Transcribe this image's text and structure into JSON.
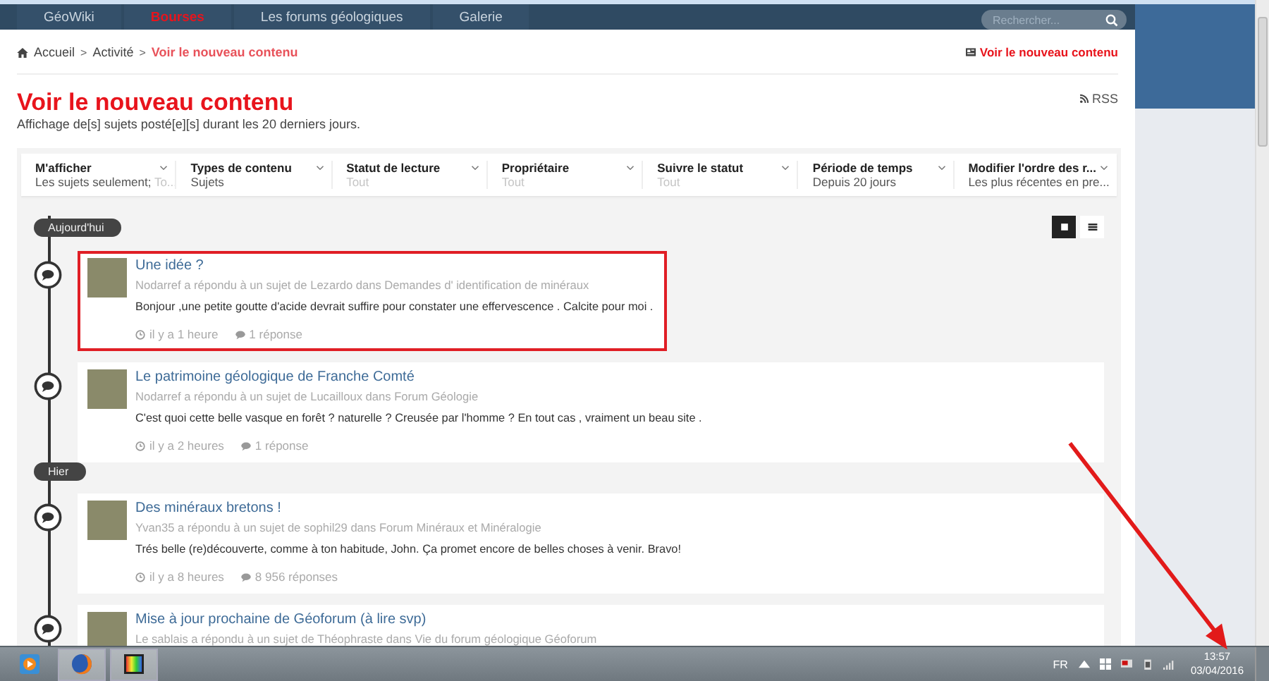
{
  "nav": {
    "items": [
      {
        "label": "GéoWiki",
        "selected": false
      },
      {
        "label": "Bourses",
        "selected": true
      },
      {
        "label": "Les forums géologiques",
        "selected": false
      },
      {
        "label": "Galerie",
        "selected": false
      }
    ],
    "search": {
      "placeholder": "Rechercher..."
    }
  },
  "breadcrumb": {
    "items": [
      {
        "label": "Accueil",
        "current": false
      },
      {
        "label": "Activité",
        "current": false
      },
      {
        "label": "Voir le nouveau contenu",
        "current": true
      }
    ],
    "separator": ">",
    "link": "Voir le nouveau contenu"
  },
  "title": "Voir le nouveau contenu",
  "subtitle": "Affichage de[s] sujets posté[e][s] durant les 20 derniers jours.",
  "rss": "RSS",
  "filters": [
    {
      "label": "M'afficher",
      "value": "Les sujets seulement;",
      "extra": "To...",
      "muted": false
    },
    {
      "label": "Types de contenu",
      "value": "Sujets",
      "muted": false
    },
    {
      "label": "Statut de lecture",
      "value": "Tout",
      "muted": true
    },
    {
      "label": "Propriétaire",
      "value": "Tout",
      "muted": true
    },
    {
      "label": "Suivre le statut",
      "value": "Tout",
      "muted": true
    },
    {
      "label": "Période de temps",
      "value": "Depuis 20 jours",
      "muted": false
    },
    {
      "label": "Modifier l'ordre des r...",
      "value": "Les plus récentes en pre...",
      "muted": false
    }
  ],
  "view_modes": [
    {
      "kind": "expanded",
      "selected": true
    },
    {
      "kind": "condensed",
      "selected": false
    }
  ],
  "groups": [
    {
      "label": "Aujourd'hui",
      "posts": [
        {
          "title": "Une idée ?",
          "meta": "Nodarref a répondu à un sujet de Lezardo dans Demandes d' identification de minéraux",
          "excerpt": "Bonjour ,une petite goutte d'acide devrait suffire pour constater une effervescence . Calcite pour moi .",
          "time": "il y a 1 heure",
          "replies": "1 réponse",
          "highlighted": true
        },
        {
          "title": "Le patrimoine géologique de Franche Comté",
          "meta": "Nodarref a répondu à un sujet de Lucailloux dans Forum Géologie",
          "excerpt": "C'est quoi cette belle vasque en forêt ? naturelle ? Creusée par l'homme ? En tout cas , vraiment un beau site .",
          "time": "il y a 2 heures",
          "replies": "1 réponse",
          "highlighted": false
        }
      ]
    },
    {
      "label": "Hier",
      "posts": [
        {
          "title": "Des minéraux bretons !",
          "meta": "Yvan35 a répondu à un sujet de sophil29 dans Forum Minéraux et Minéralogie",
          "excerpt": "Trés belle (re)découverte, comme à ton habitude, John. Ça promet encore de belles choses à venir. Bravo!",
          "time": "il y a 8 heures",
          "replies": "8 956 réponses",
          "highlighted": false
        },
        {
          "title": "Mise à jour prochaine de Géoforum (à lire svp)",
          "meta": "Le sablais a répondu à un sujet de Théophraste dans Vie du forum géologique Géoforum",
          "highlighted": false
        }
      ]
    }
  ],
  "taskbar": {
    "language": "FR",
    "time": "13:57",
    "date": "03/04/2016"
  }
}
